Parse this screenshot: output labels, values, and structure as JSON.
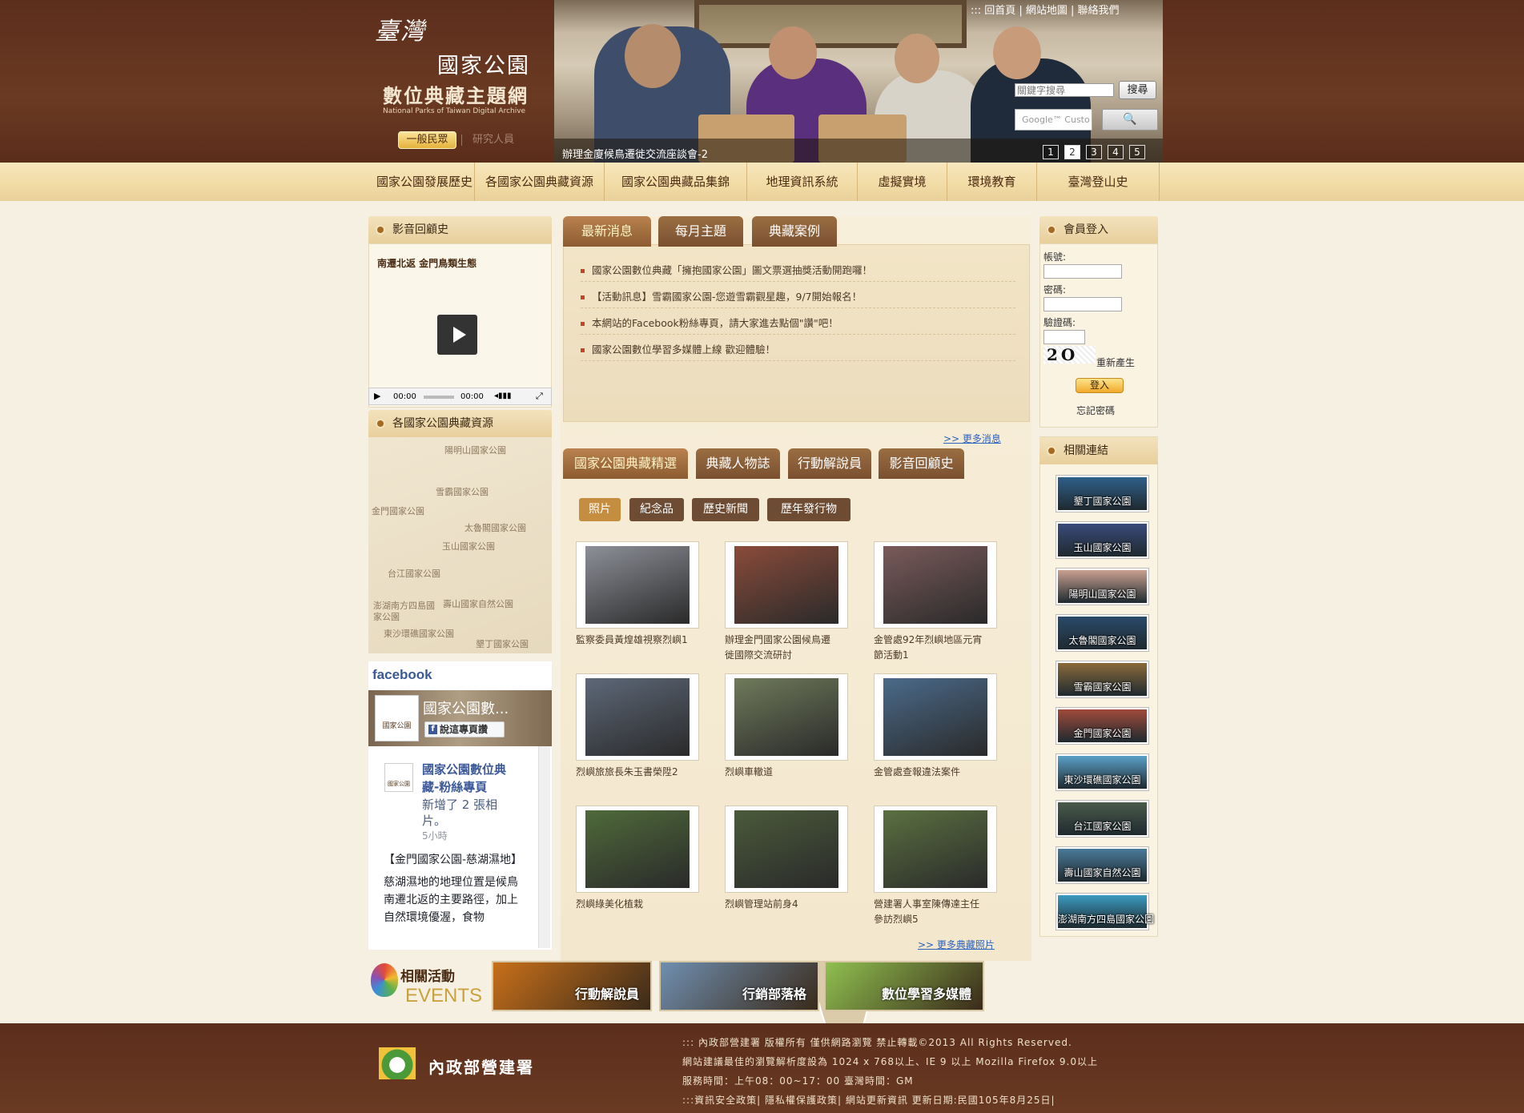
{
  "site": {
    "logo_line1": "臺灣",
    "logo_line2": "國家公園",
    "logo_line3": "數位典藏主題網",
    "logo_en": "National Parks of Taiwan Digital Archive",
    "role_public": "一般民眾",
    "role_research": "研究人員"
  },
  "top_links": "::: 回首頁 | 網站地圖 | 聯絡我們",
  "search": {
    "placeholder": "關鍵字搜尋",
    "button": "搜尋",
    "google_placeholder": "Google™ Custo",
    "google_button": "🔍"
  },
  "banner": {
    "caption": "辦理金廈候鳥遷徙交流座談會-2",
    "pages": [
      "1",
      "2",
      "3",
      "4",
      "5"
    ],
    "active_page": "2"
  },
  "nav": [
    "國家公園發展歷史",
    "各國家公園典藏資源",
    "國家公園典藏品集錦",
    "地理資訊系統",
    "虛擬實境",
    "環境教育",
    "臺灣登山史"
  ],
  "video": {
    "heading": "影音回顧史",
    "title": "南遷北返 金門鳥類生態",
    "time_current": "00:00",
    "time_total": "00:00"
  },
  "resources": {
    "heading": "各國家公園典藏資源",
    "map_labels": [
      "陽明山國家公園",
      "雪霸國家公園",
      "金門國家公園",
      "太魯閣國家公園",
      "玉山國家公園",
      "台江國家公園",
      "壽山國家自然公園",
      "澎湖南方四島國家公園",
      "東沙環礁國家公園",
      "墾丁國家公園"
    ]
  },
  "facebook": {
    "logo": "facebook",
    "page_name": "國家公園數...",
    "like_button": "說這專頁讚",
    "avatar_text": "國家公園",
    "post_author": "國家公園數位典藏-粉絲專頁",
    "post_meta": "新增了 2 張相片。",
    "post_time": "5小時",
    "post_body1": "【金門國家公園-慈湖濕地】",
    "post_body2": "慈湖濕地的地理位置是候鳥南遷北返的主要路徑，加上自然環境優渥，食物"
  },
  "news_tabs": [
    "最新消息",
    "每月主題",
    "典藏案例"
  ],
  "news": [
    "國家公園數位典藏「擁抱國家公園」圖文票選抽獎活動開跑囉！",
    "【活動訊息】雪霸國家公園-您遊雪霸觀星趣，9/7開始報名！",
    "本網站的Facebook粉絲專頁，請大家進去點個\"讚\"吧！",
    "國家公園數位學習多媒體上線 歡迎體驗！"
  ],
  "more_news": ">> 更多消息",
  "collection_tabs": [
    "國家公園典藏精選",
    "典藏人物誌",
    "行動解說員",
    "影音回顧史"
  ],
  "sub_tabs": [
    "照片",
    "紀念品",
    "歷史新聞",
    "歷年發行物"
  ],
  "photos": [
    {
      "caption": "監察委員黃煌雄視察烈嶼1",
      "color": "#8d9098"
    },
    {
      "caption": "辦理金門國家公園候鳥遷徙國際交流研討",
      "color": "#8a4b3a"
    },
    {
      "caption": "金管處92年烈嶼地區元宵節活動1",
      "color": "#7a5a5a"
    },
    {
      "caption": "烈嶼旅旅長朱玉書榮陞2",
      "color": "#5d6878"
    },
    {
      "caption": "烈嶼車轍道",
      "color": "#6f7a5a"
    },
    {
      "caption": "金管處查報違法案件",
      "color": "#4a6a8a"
    },
    {
      "caption": "烈嶼綠美化植栽",
      "color": "#4f6a3a"
    },
    {
      "caption": "烈嶼管理站前身4",
      "color": "#4a5a3a"
    },
    {
      "caption": "營建署人事室陳傳達主任參訪烈嶼5",
      "color": "#5a7040"
    }
  ],
  "more_photos": ">> 更多典藏照片",
  "login": {
    "heading": "會員登入",
    "account_label": "帳號:",
    "password_label": "密碼:",
    "captcha_label": "驗證碼:",
    "captcha_text": "2O",
    "regenerate": "重新產生",
    "login_button": "登入",
    "forgot": "忘記密碼"
  },
  "links": {
    "heading": "相關連結",
    "parks": [
      {
        "name": "墾丁國家公園",
        "color": "#2f5f8a"
      },
      {
        "name": "玉山國家公園",
        "color": "#3a4a7a"
      },
      {
        "name": "陽明山國家公園",
        "color": "#c9a090"
      },
      {
        "name": "太魯閣國家公園",
        "color": "#2a4a6a"
      },
      {
        "name": "雪霸國家公園",
        "color": "#8a6a3a"
      },
      {
        "name": "金門國家公園",
        "color": "#a04a3a"
      },
      {
        "name": "東沙環礁國家公園",
        "color": "#5aa0c8"
      },
      {
        "name": "台江國家公園",
        "color": "#4a5a4a"
      },
      {
        "name": "壽山國家自然公園",
        "color": "#4a7a9a"
      },
      {
        "name": "澎湖南方四島國家公園",
        "color": "#3a9ac0"
      }
    ]
  },
  "events": {
    "title": "相關活動",
    "title_en": "EVENTS",
    "items": [
      {
        "label": "行動解說員",
        "color": "#c8701a"
      },
      {
        "label": "行銷部落格",
        "color": "#6f8fb0"
      },
      {
        "label": "數位學習多媒體",
        "color": "#8fc050"
      }
    ]
  },
  "footer": {
    "org": "內政部營建署",
    "line1": "::: 內政部營建署 版權所有 僅供網路瀏覽 禁止轉載©2013 All Rights Reserved.",
    "line2": "網站建議最佳的瀏覽解析度設為 1024 x 768以上、IE 9 以上 Mozilla Firefox 9.0以上",
    "line3": "服務時間：上午08：00~17：00 臺灣時間：GM",
    "line4": ":::資訊安全政策| 隱私權保護政策| 網站更新資訊 更新日期:民國105年8月25日|"
  }
}
